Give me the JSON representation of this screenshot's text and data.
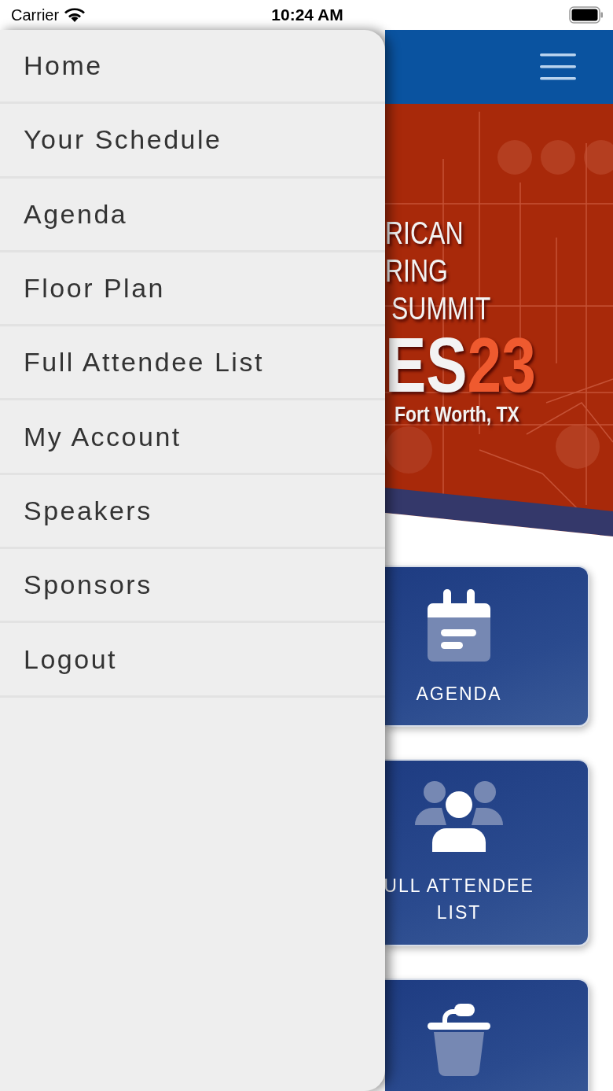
{
  "status_bar": {
    "carrier": "Carrier",
    "time": "10:24 AM"
  },
  "menu": {
    "items": [
      {
        "label": "Home"
      },
      {
        "label": "Your Schedule"
      },
      {
        "label": "Agenda"
      },
      {
        "label": "Floor Plan"
      },
      {
        "label": "Full Attendee List"
      },
      {
        "label": "My Account"
      },
      {
        "label": "Speakers"
      },
      {
        "label": "Sponsors"
      },
      {
        "label": "Logout"
      }
    ]
  },
  "banner": {
    "lines": [
      "RICAN",
      "RING",
      "SUMMIT"
    ],
    "title": "ES",
    "year": "23",
    "location": "Fort Worth, TX"
  },
  "tiles": [
    {
      "kind": "calendar",
      "lines": [
        "AGENDA"
      ]
    },
    {
      "kind": "people",
      "lines": [
        "ULL ATTENDEE",
        "LIST"
      ]
    },
    {
      "kind": "podium"
    }
  ]
}
